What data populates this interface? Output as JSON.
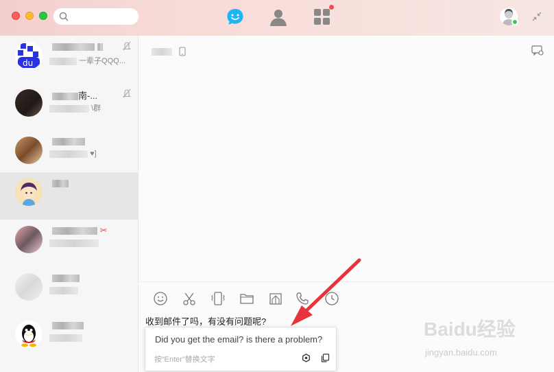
{
  "sidebar": {
    "conversations": [
      {
        "name_suffix": "",
        "preview_tail": "一辈子QQQ..."
      },
      {
        "name_suffix": "南-...",
        "preview_tail": "\\群"
      },
      {
        "name_suffix": "",
        "preview_tail": "♥]"
      },
      {
        "name_suffix": "",
        "preview_tail": ""
      },
      {
        "name_suffix": "",
        "preview_tail": ""
      },
      {
        "name_suffix": "",
        "preview_tail": ""
      },
      {
        "name_suffix": "",
        "preview_tail": ""
      }
    ]
  },
  "composer": {
    "input_text": "收到邮件了吗，有没有问题呢?",
    "translation": "Did you get the email? is there a problem?",
    "hint": "按“Enter”替换文字"
  },
  "watermark": {
    "logo": "Baidu经验",
    "url": "jingyan.baidu.com"
  },
  "icons": {
    "nav": [
      "chat-icon",
      "contacts-icon",
      "apps-icon"
    ],
    "toolbar": [
      "emoji-icon",
      "screenshot-icon",
      "shake-icon",
      "folder-icon",
      "image-icon",
      "phone-icon",
      "history-icon"
    ]
  },
  "colors": {
    "accent": "#1fb4f5",
    "close": "#fc5f57",
    "arrow": "#e8333f"
  }
}
